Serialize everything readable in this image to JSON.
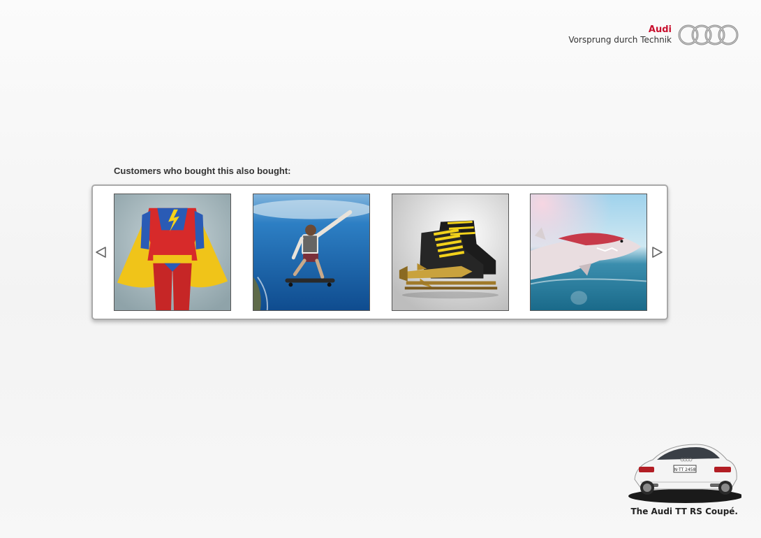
{
  "brand": {
    "name": "Audi",
    "tagline": "Vorsprung durch Technik",
    "logo_icon": "four-rings-icon",
    "accent_color": "#c8102e"
  },
  "carousel": {
    "title": "Customers who bought this also bought:",
    "prev_icon": "chevron-left-icon",
    "next_icon": "chevron-right-icon",
    "items": [
      {
        "image": "superhero-costume-photo"
      },
      {
        "image": "skydiving-skateboarder-photo"
      },
      {
        "image": "rocket-ice-skates-photo"
      },
      {
        "image": "shark-jet-ski-photo"
      }
    ]
  },
  "footer": {
    "car_image": "audi-tt-rs-coupe-photo",
    "caption": "The Audi TT RS Coupé."
  }
}
